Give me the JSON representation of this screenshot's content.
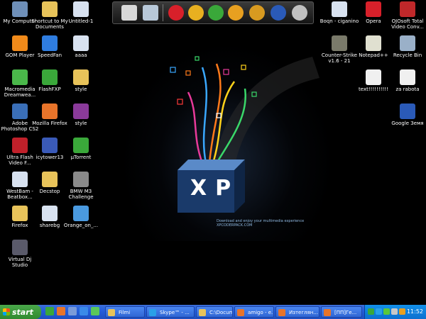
{
  "desktop": {
    "icons_left": [
      {
        "label": "My Computer",
        "icon": "computer-icon",
        "color": "#6e8fb8"
      },
      {
        "label": "Shortcut to My Documents",
        "icon": "folder-icon",
        "color": "#e8c35a"
      },
      {
        "label": "Untitled-1",
        "icon": "document-icon",
        "color": "#d8e2f0"
      },
      {
        "label": "GOM Player",
        "icon": "gom-player-icon",
        "color": "#f08a1a"
      },
      {
        "label": "SpeedFan",
        "icon": "speedfan-icon",
        "color": "#2f7de0"
      },
      {
        "label": "aaaa",
        "icon": "document-icon",
        "color": "#d8e2f0"
      },
      {
        "label": "Macromedia Dreamwea...",
        "icon": "dreamweaver-icon",
        "color": "#4ab84a"
      },
      {
        "label": "FlashFXP",
        "icon": "flashfxp-icon",
        "color": "#3aa83a"
      },
      {
        "label": "style",
        "icon": "folder-icon",
        "color": "#e8c35a"
      },
      {
        "label": "Adobe Photoshop CS2",
        "icon": "photoshop-icon",
        "color": "#3a6fb8"
      },
      {
        "label": "Mozilla Firefox",
        "icon": "firefox-icon",
        "color": "#e8742a"
      },
      {
        "label": "style",
        "icon": "winrar-icon",
        "color": "#8a3a9a"
      },
      {
        "label": "Ultra Flash Video F...",
        "icon": "ultra-flash-icon",
        "color": "#c0202a"
      },
      {
        "label": "icytower13",
        "icon": "icytower-icon",
        "color": "#3a5ab8"
      },
      {
        "label": "µTorrent",
        "icon": "utorrent-icon",
        "color": "#3aa83a"
      },
      {
        "label": "WestBam - Beatbox...",
        "icon": "document-icon",
        "color": "#d8e2f0"
      },
      {
        "label": "Decstop",
        "icon": "folder-icon",
        "color": "#e8c35a"
      },
      {
        "label": "BMW M3 Challenge",
        "icon": "bmw-icon",
        "color": "#8a8a8a"
      },
      {
        "label": "Firefox",
        "icon": "folder-icon",
        "color": "#e8c35a"
      },
      {
        "label": "sharebg",
        "icon": "document-icon",
        "color": "#d8e2f0"
      },
      {
        "label": "Orange_on_...",
        "icon": "image-icon",
        "color": "#4a9ae0"
      },
      {
        "label": "Virtual Dj Studio",
        "icon": "virtual-dj-icon",
        "color": "#5a5a6a"
      }
    ],
    "icons_right": [
      {
        "label": "Boqn - ciganino",
        "icon": "audio-file-icon",
        "color": "#d8e2f0"
      },
      {
        "label": "Opera",
        "icon": "opera-icon",
        "color": "#d8202a"
      },
      {
        "label": "OJOsoft Total Video Conv...",
        "icon": "ojosoft-icon",
        "color": "#c0282a"
      },
      {
        "label": "Counter-Strike v1.6 - 21",
        "icon": "counter-strike-icon",
        "color": "#7a7a6a"
      },
      {
        "label": "Notepad++",
        "icon": "notepad-icon",
        "color": "#e0e0d0"
      },
      {
        "label": "Recycle Bin",
        "icon": "recycle-bin-icon",
        "color": "#9ab0c8"
      },
      {
        "label": "text!!!!!!!!!!",
        "icon": "text-file-icon",
        "color": "#f0f0f0"
      },
      {
        "label": "za rabota",
        "icon": "text-file-icon",
        "color": "#f0f0f0"
      },
      {
        "label": "Google Земя",
        "icon": "google-earth-icon",
        "color": "#2a5ab8"
      }
    ]
  },
  "wallpaper": {
    "logo_text": "XP",
    "tagline": "Download and enjoy your multimedia experience",
    "site": "XPCODERPACK.COM"
  },
  "dock": {
    "items": [
      {
        "icon": "document-icon",
        "color": "#d8d8d8"
      },
      {
        "icon": "recycle-bin-icon",
        "color": "#b8c8d8"
      },
      {
        "icon": "opera-icon",
        "color": "#d8202a"
      },
      {
        "icon": "chrome-icon",
        "color": "#e8b020"
      },
      {
        "icon": "flashfxp-icon",
        "color": "#3aa83a"
      },
      {
        "icon": "winamp-icon",
        "color": "#e8a020"
      },
      {
        "icon": "rocketdock-icon",
        "color": "#d89a20"
      },
      {
        "icon": "google-earth-icon",
        "color": "#2a5ab8"
      },
      {
        "icon": "tools-icon",
        "color": "#c0c0c0"
      }
    ]
  },
  "taskbar": {
    "start_label": "start",
    "tasks": [
      {
        "label": "Filmi",
        "color": "#e8c35a"
      },
      {
        "label": "Skype™ - ...",
        "color": "#2aa0e8"
      },
      {
        "label": "C:\\Docum...",
        "color": "#e8c35a"
      },
      {
        "label": "amigo - e...",
        "color": "#e8742a"
      },
      {
        "label": "Изтеглян...",
        "color": "#e8742a"
      },
      {
        "label": "[ПП]Ге...",
        "color": "#e8742a"
      }
    ],
    "clock": "11:52"
  }
}
